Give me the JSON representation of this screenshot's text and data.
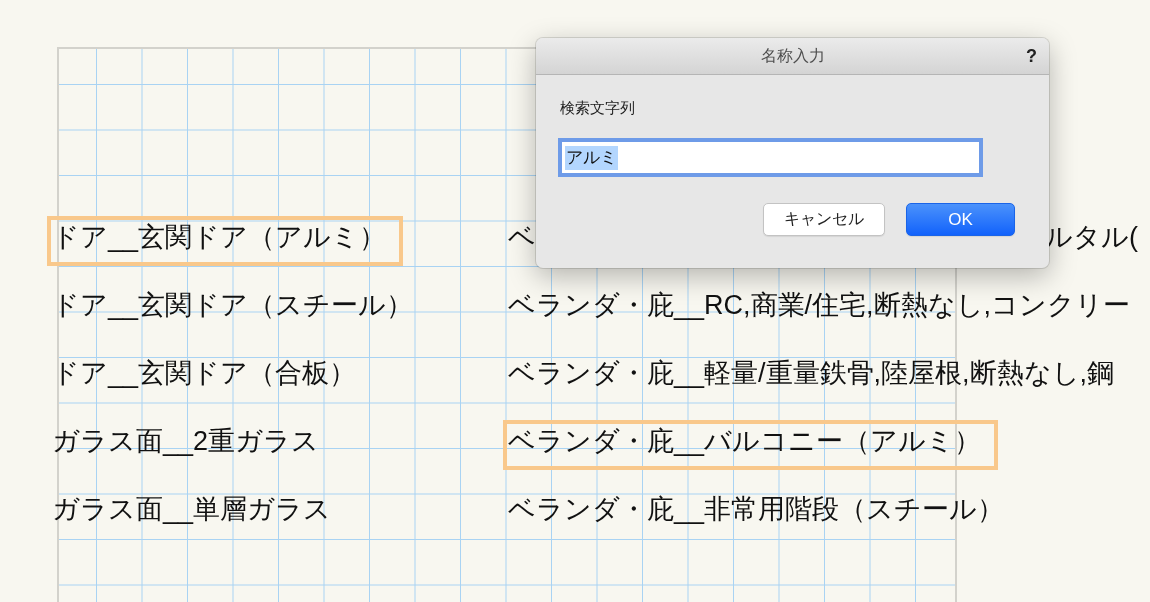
{
  "sheet": {
    "columns": [
      {
        "items": [
          {
            "kind": "text",
            "text": "ドア__玄関ドア（アルミ）",
            "highlighted": true
          },
          {
            "kind": "text",
            "text": "ドア__玄関ドア（スチール）",
            "highlighted": false
          },
          {
            "kind": "text",
            "text": "ドア__玄関ドア（合板）",
            "highlighted": false
          },
          {
            "kind": "text",
            "text": "ガラス面__2重ガラス",
            "highlighted": false
          },
          {
            "kind": "text",
            "text": "ガラス面__単層ガラス",
            "highlighted": false
          }
        ]
      },
      {
        "items": [
          {
            "kind": "covered",
            "visible_parts": [
              "ベ",
              "ルタル("
            ],
            "highlighted": false
          },
          {
            "kind": "text",
            "text": "ベランダ・庇__RC,商業/住宅,断熱なし,コンクリー",
            "highlighted": false
          },
          {
            "kind": "text",
            "text": "ベランダ・庇__軽量/重量鉄骨,陸屋根,断熱なし,鋼",
            "highlighted": false
          },
          {
            "kind": "text",
            "text": "ベランダ・庇__バルコニー（アルミ）",
            "highlighted": true
          },
          {
            "kind": "text",
            "text": "ベランダ・庇__非常用階段（スチール）",
            "highlighted": false
          }
        ]
      }
    ]
  },
  "dialog": {
    "title": "名称入力",
    "help": "?",
    "field": {
      "label": "検索文字列",
      "value": "アルミ",
      "focused": true,
      "text_selected": true
    },
    "buttons": [
      {
        "label": "キャンセル",
        "default": false
      },
      {
        "label": "OK",
        "default": true
      }
    ]
  }
}
